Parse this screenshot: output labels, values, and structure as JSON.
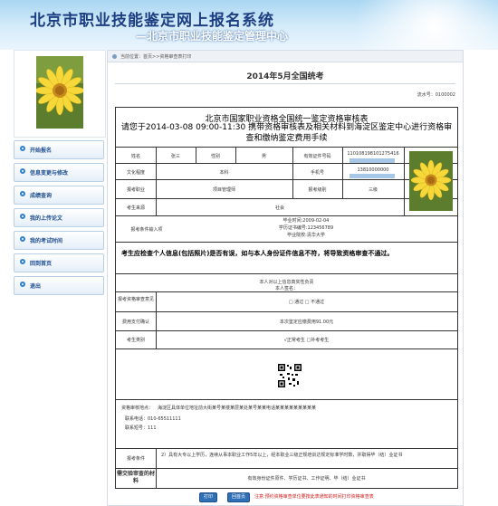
{
  "header": {
    "title": "北京市职业技能鉴定网上报名系统",
    "subtitle": "—北京市职业技能鉴定管理中心"
  },
  "sidebar": {
    "items": [
      {
        "label": "开始报名",
        "icon": "circle-icon"
      },
      {
        "label": "信息变更与修改",
        "icon": "circle-icon"
      },
      {
        "label": "成绩查询",
        "icon": "circle-icon"
      },
      {
        "label": "我的上传论文",
        "icon": "circle-icon"
      },
      {
        "label": "我的考试时间",
        "icon": "circle-icon"
      },
      {
        "label": "回到首页",
        "icon": "circle-icon"
      },
      {
        "label": "退出",
        "icon": "circle-icon"
      }
    ]
  },
  "breadcrumb": "当前位置：首页>>资格审查表打印",
  "exam_title": "2014年5月全国统考",
  "table_no": "流水号：0100002",
  "form": {
    "title": "北京市国家职业资格全国统一鉴定资格审核表",
    "notice": "请您于2014-03-08 09:00-11:30 携带资格审核表及相关材料到海淀区鉴定中心进行资格审查和缴纳鉴定费用手续",
    "labels": {
      "name": "姓名",
      "gender": "性别",
      "id_no": "有效证件号码",
      "education": "文化程度",
      "phone": "手机号",
      "occupation": "报考职业",
      "level": "报考级别",
      "source": "考生来源",
      "address_label": "报考条件输入项",
      "signature": "本人签名：",
      "review": "报考资格审查意见",
      "payment": "费用支付确认",
      "exam_type": "考生类别",
      "conditions": "报考条件",
      "materials": "需交验审查的材料",
      "contact": "资格审核地点："
    },
    "values": {
      "name": "张三",
      "gender": "男",
      "id_no": "110108198101275416",
      "education": "本科",
      "phone": "13810000000",
      "occupation": "项目管理师",
      "level": "三级",
      "source": "社会",
      "work_time": "毕业时间:2009-02-04",
      "student_no": "学历证书编号:123456789",
      "school": "毕业院校:清华大学"
    },
    "warning": "考生应检查个人信息(包括照片)是否有误，如与本人身份证件信息不符，将导致资格审查不通过。",
    "responsibility": "本人对以上信息真实性负责",
    "review_options": "□ 通过    □ 不通过",
    "payment_text": "本次鉴定应缴费用91.00元",
    "exam_type_text": "√正常考生    □补考考生",
    "address_detail": "海淀区具体单位地址前大街某号某楼某层某处某号某某电话某某某某某某某某某",
    "contact_phone": "联系电话：010-65511111",
    "contact_ext": "联系短号：111",
    "conditions_text": "2）具有大专以上学历，连续从事本职业工作5年以上，经本职业三级正规培训达规定标准学时数，并取得毕（结）业证书",
    "materials_text": "有效身份证件原件、学历证书、工作证明、毕（结）业证书"
  },
  "buttons": {
    "print": "打印",
    "back": "回首页"
  },
  "red_note": "注意:预约资格审查单位要按此表通知的时间打印资格审查表",
  "colors": {
    "banner": "#a9d6f2",
    "title": "#1d3f82",
    "accent": "#2f6fb6",
    "warn": "#d01a1a"
  }
}
